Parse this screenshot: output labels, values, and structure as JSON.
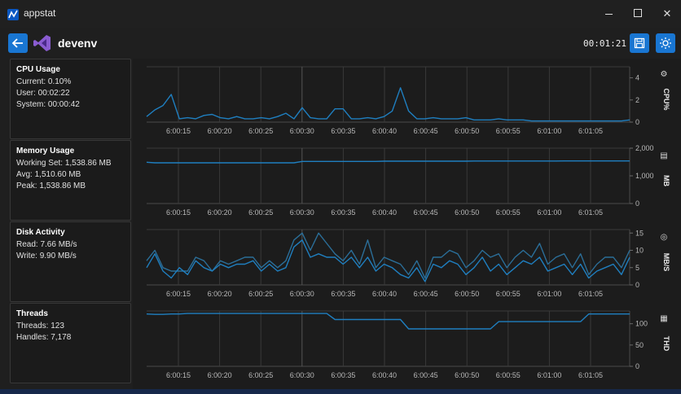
{
  "window": {
    "title": "appstat"
  },
  "header": {
    "process_name": "devenv",
    "elapsed": "00:01:21"
  },
  "colors": {
    "accent": "#1976d2",
    "series": "#1f7fc0",
    "series_secondary": "#2b6e98",
    "background": "#1f1f1f"
  },
  "icons": {
    "back": "arrow-left-icon",
    "save": "floppy-disk-icon",
    "theme": "sun-icon",
    "cpu": "chip-icon",
    "memory": "memory-stick-icon",
    "disk": "database-icon",
    "threads": "thread-spool-icon"
  },
  "panels": {
    "cpu": {
      "title": "CPU Usage",
      "lines": [
        "Current: 0.10%",
        "User: 00:02:22",
        "System: 00:00:42"
      ]
    },
    "memory": {
      "title": "Memory Usage",
      "lines": [
        "Working Set: 1,538.86 MB",
        "Avg: 1,510.60 MB",
        "Peak: 1,538.86 MB"
      ]
    },
    "disk": {
      "title": "Disk Activity",
      "lines": [
        "Read: 7.66 MB/s",
        "Write: 9.90 MB/s"
      ]
    },
    "threads": {
      "title": "Threads",
      "lines": [
        "Threads: 123",
        "Handles: 7,178"
      ]
    }
  },
  "chart_data": [
    {
      "type": "line",
      "ylabel": "CPU%",
      "ylim": [
        0,
        5
      ],
      "yticks": [
        "4",
        "2",
        "0"
      ],
      "ytick_values": [
        4,
        2,
        0
      ],
      "x_ticks": [
        "6:00:15",
        "6:00:20",
        "6:00:25",
        "6:00:30",
        "6:00:35",
        "6:00:40",
        "6:00:45",
        "6:00:50",
        "6:00:55",
        "6:01:00",
        "6:01:05"
      ],
      "series": [
        {
          "values": [
            0.5,
            1.1,
            1.5,
            2.5,
            0.3,
            0.4,
            0.3,
            0.6,
            0.7,
            0.4,
            0.3,
            0.5,
            0.3,
            0.3,
            0.4,
            0.3,
            0.5,
            0.8,
            0.3,
            1.3,
            0.4,
            0.3,
            0.3,
            1.2,
            1.2,
            0.3,
            0.3,
            0.4,
            0.3,
            0.5,
            1.0,
            3.1,
            1.0,
            0.3,
            0.3,
            0.4,
            0.3,
            0.3,
            0.3,
            0.4,
            0.2,
            0.2,
            0.2,
            0.3,
            0.2,
            0.2,
            0.2,
            0.1,
            0.1,
            0.1,
            0.1,
            0.1,
            0.1,
            0.1,
            0.1,
            0.1,
            0.1,
            0.1,
            0.1,
            0.2
          ]
        }
      ]
    },
    {
      "type": "line",
      "ylabel": "MB",
      "ylim": [
        0,
        2000
      ],
      "yticks": [
        "2,000",
        "1,000",
        "0"
      ],
      "ytick_values": [
        2000,
        1000,
        0
      ],
      "x_ticks": [
        "6:00:15",
        "6:00:20",
        "6:00:25",
        "6:00:30",
        "6:00:35",
        "6:00:40",
        "6:00:45",
        "6:00:50",
        "6:00:55",
        "6:01:00",
        "6:01:05"
      ],
      "series": [
        {
          "values": [
            1490,
            1470,
            1470,
            1470,
            1470,
            1470,
            1470,
            1470,
            1470,
            1470,
            1470,
            1470,
            1470,
            1470,
            1470,
            1470,
            1470,
            1470,
            1470,
            1520,
            1520,
            1520,
            1520,
            1520,
            1520,
            1520,
            1520,
            1520,
            1520,
            1530,
            1530,
            1530,
            1530,
            1530,
            1530,
            1530,
            1530,
            1530,
            1530,
            1530,
            1535,
            1535,
            1535,
            1535,
            1535,
            1535,
            1535,
            1535,
            1535,
            1535,
            1535,
            1538,
            1538,
            1538,
            1538,
            1538,
            1538,
            1538,
            1538,
            1538
          ]
        }
      ]
    },
    {
      "type": "line",
      "ylabel": "MB/S",
      "ylim": [
        0,
        16
      ],
      "yticks": [
        "15",
        "10",
        "5",
        "0"
      ],
      "ytick_values": [
        15,
        10,
        5,
        0
      ],
      "x_ticks": [
        "6:00:15",
        "6:00:20",
        "6:00:25",
        "6:00:30",
        "6:00:35",
        "6:00:40",
        "6:00:45",
        "6:00:50",
        "6:00:55",
        "6:01:00",
        "6:01:05"
      ],
      "series": [
        {
          "values": [
            5,
            9,
            4,
            2,
            5,
            3,
            7,
            5,
            4,
            6,
            5,
            6,
            6,
            7,
            4,
            6,
            4,
            5,
            11,
            13,
            8,
            9,
            8,
            8,
            6,
            8,
            5,
            8,
            4,
            6,
            5,
            3,
            2,
            5,
            1,
            6,
            5,
            7,
            6,
            3,
            5,
            8,
            4,
            6,
            3,
            5,
            7,
            6,
            8,
            4,
            5,
            6,
            3,
            6,
            2,
            4,
            5,
            6,
            3,
            8
          ]
        },
        {
          "values": [
            7,
            10,
            5,
            4,
            4,
            4,
            8,
            7,
            4,
            7,
            6,
            7,
            8,
            8,
            5,
            7,
            5,
            7,
            13,
            15,
            10,
            15,
            12,
            9,
            7,
            10,
            6,
            13,
            5,
            8,
            7,
            6,
            3,
            7,
            2,
            8,
            8,
            10,
            9,
            5,
            7,
            10,
            8,
            9,
            5,
            8,
            10,
            8,
            12,
            6,
            8,
            9,
            5,
            9,
            3,
            6,
            8,
            8,
            5,
            10
          ]
        }
      ]
    },
    {
      "type": "line",
      "ylabel": "THD",
      "ylim": [
        0,
        130
      ],
      "yticks": [
        "100",
        "50",
        "0"
      ],
      "ytick_values": [
        100,
        50,
        0
      ],
      "x_ticks": [
        "6:00:15",
        "6:00:20",
        "6:00:25",
        "6:00:30",
        "6:00:35",
        "6:00:40",
        "6:00:45",
        "6:00:50",
        "6:00:55",
        "6:01:00",
        "6:01:05"
      ],
      "series": [
        {
          "values": [
            123,
            122,
            122,
            123,
            123,
            124,
            124,
            124,
            124,
            124,
            124,
            124,
            124,
            124,
            124,
            124,
            124,
            124,
            124,
            124,
            124,
            124,
            124,
            110,
            110,
            110,
            110,
            110,
            110,
            110,
            110,
            110,
            88,
            88,
            88,
            88,
            88,
            88,
            88,
            88,
            88,
            88,
            88,
            105,
            105,
            105,
            105,
            105,
            105,
            105,
            105,
            105,
            105,
            105,
            123,
            123,
            123,
            123,
            123,
            123
          ]
        }
      ]
    }
  ]
}
